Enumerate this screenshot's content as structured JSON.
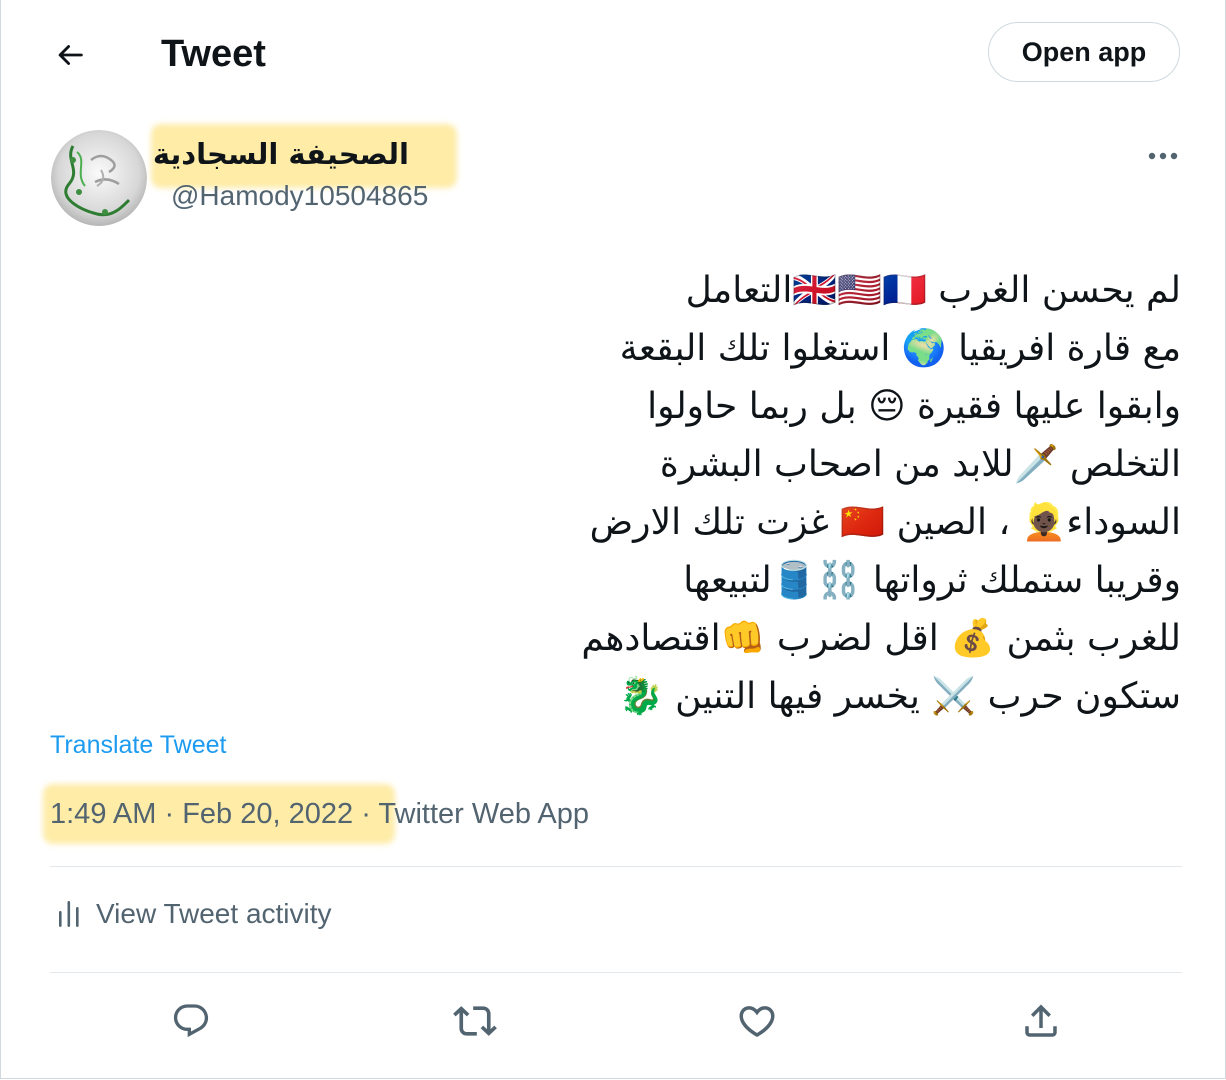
{
  "header": {
    "title": "Tweet",
    "open_app_label": "Open app",
    "back_icon": "arrow-left-icon"
  },
  "author": {
    "display_name": "الصحيفة السجادية",
    "handle": "@Hamody10504865",
    "avatar_icon": "avatar-calligraphy-image"
  },
  "tweet": {
    "lines": [
      "لم يحسن الغرب 🇬🇧🇺🇸🇫🇷التعامل",
      "مع قارة افريقيا 🌍 استغلوا  تلك البقعة",
      "وابقوا عليها فقيرة 😔 بل ربما حاولوا",
      "التخلص 🗡️للابد من اصحاب البشرة",
      "السوداء👱🏿 ، الصين 🇨🇳 غزت تلك الارض",
      "وقريبا ستملك ثرواتها ⛓️🛢️لتبيعها",
      "للغرب بثمن 💰 اقل لضرب 👊اقتصادهم",
      "ستكون حرب ⚔️ يخسر فيها التنين 🐉"
    ],
    "translate_label": "Translate Tweet",
    "time": "1:49 AM",
    "separator": "·",
    "date": "Feb 20, 2022",
    "source": "Twitter Web App"
  },
  "activity": {
    "label": "View Tweet activity",
    "icon": "bar-chart-icon"
  },
  "actions": {
    "reply_icon": "reply-icon",
    "retweet_icon": "retweet-icon",
    "like_icon": "heart-icon",
    "share_icon": "share-icon"
  },
  "colors": {
    "text": "#0f1419",
    "secondary": "#536471",
    "link": "#1d9bf0",
    "highlight": "#fde68a",
    "border": "#cfd9de"
  }
}
